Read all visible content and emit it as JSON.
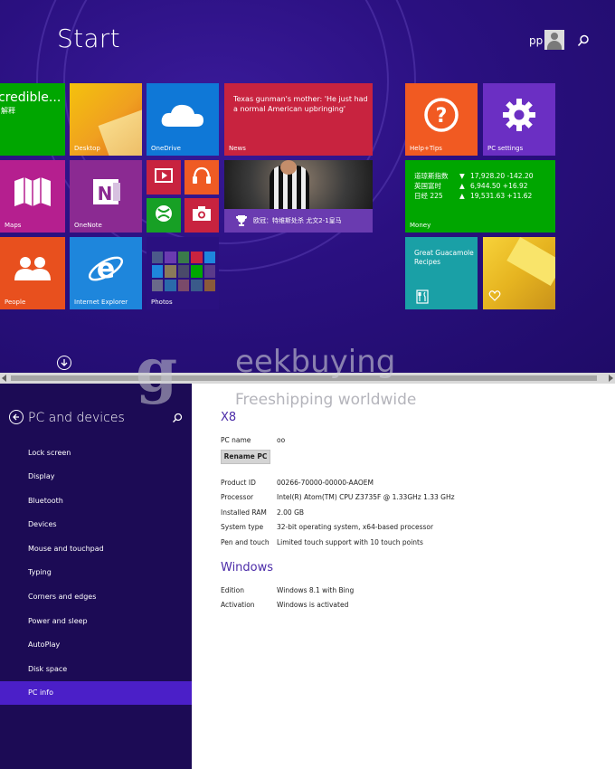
{
  "start": {
    "title": "Start",
    "user_name": "pp"
  },
  "tiles": {
    "incredible": "credible...",
    "incredible_sub": "解释",
    "desktop": "Desktop",
    "onedrive": "OneDrive",
    "news": "News",
    "news_headline": "Texas gunman's mother: 'He just had a normal American upbringing'",
    "help": "Help+Tips",
    "pc_settings": "PC settings",
    "maps": "Maps",
    "onenote": "OneNote",
    "sports_caption": "欧冠：特维斯处杀 尤文2-1皇马",
    "money": "Money",
    "money_rows": [
      {
        "name": "道琼斯指数",
        "arrow": "▼",
        "value": "17,928.20 -142.20"
      },
      {
        "name": "英国富时",
        "arrow": "▲",
        "value": "6,944.50 +16.92"
      },
      {
        "name": "日经 225",
        "arrow": "▲",
        "value": "19,531.63 +11.62"
      }
    ],
    "people": "People",
    "ie": "Internet Explorer",
    "photos": "Photos",
    "recipe": "Great Guacamole Recipes"
  },
  "settings": {
    "title": "PC and devices",
    "menu": [
      {
        "label": "Lock screen",
        "active": false
      },
      {
        "label": "Display",
        "active": false
      },
      {
        "label": "Bluetooth",
        "active": false
      },
      {
        "label": "Devices",
        "active": false
      },
      {
        "label": "Mouse and touchpad",
        "active": false
      },
      {
        "label": "Typing",
        "active": false
      },
      {
        "label": "Corners and edges",
        "active": false
      },
      {
        "label": "Power and sleep",
        "active": false
      },
      {
        "label": "AutoPlay",
        "active": false
      },
      {
        "label": "Disk space",
        "active": false
      },
      {
        "label": "PC info",
        "active": true
      }
    ],
    "pc_heading": "X8",
    "pc_name_label": "PC name",
    "pc_name_value": "oo",
    "rename_button": "Rename PC",
    "specs": [
      {
        "key": "Product ID",
        "value": "00266-70000-00000-AAOEM"
      },
      {
        "key": "Processor",
        "value": "Intel(R) Atom(TM) CPU  Z3735F @ 1.33GHz   1.33 GHz"
      },
      {
        "key": "Installed RAM",
        "value": "2.00 GB"
      },
      {
        "key": "System type",
        "value": "32-bit operating system, x64-based processor"
      },
      {
        "key": "Pen and touch",
        "value": "Limited touch support with 10 touch points"
      }
    ],
    "windows_heading": "Windows",
    "windows_info": [
      {
        "key": "Edition",
        "value": "Windows 8.1 with Bing"
      },
      {
        "key": "Activation",
        "value": "Windows is activated"
      }
    ]
  },
  "watermark": {
    "letter": "g",
    "word": "eekbuying",
    "tagline": "Freeshipping worldwide"
  },
  "colors": {
    "start_bg": "#2a1080",
    "green": "#00a600",
    "orange": "#f39c12",
    "blue": "#1e7ad6",
    "red": "#d22c48",
    "purple": "#7a2fd0",
    "accent": "#4b1fc8"
  }
}
